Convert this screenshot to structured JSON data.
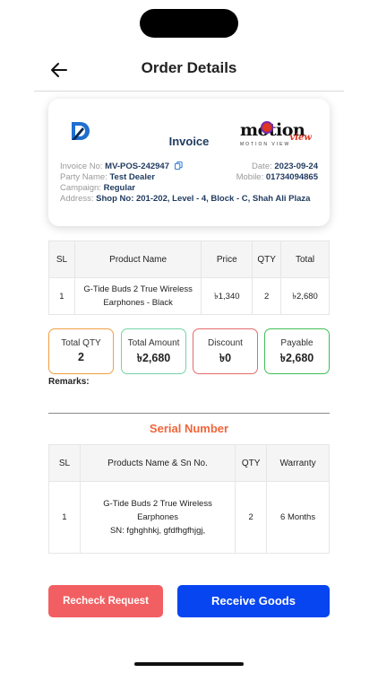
{
  "header": {
    "title": "Order Details",
    "back_icon": "arrow-left-icon"
  },
  "invoice": {
    "title": "Invoice",
    "brand": {
      "main": "motion",
      "accent": "view",
      "sub": "MOTION VIEW"
    },
    "invoice_no_label": "Invoice No:",
    "invoice_no": "MV-POS-242947",
    "date_label": "Date:",
    "date": "2023-09-24",
    "party_label": "Party Name:",
    "party": "Test Dealer",
    "mobile_label": "Mobile:",
    "mobile": "01734094865",
    "campaign_label": "Campaign:",
    "campaign": "Regular",
    "address_label": "Address:",
    "address": "Shop No: 201-202, Level - 4, Block - C, Shah Ali Plaza"
  },
  "products": {
    "headers": [
      "SL",
      "Product Name",
      "Price",
      "QTY",
      "Total"
    ],
    "rows": [
      {
        "sl": "1",
        "name": "G-Tide Buds 2 True Wireless Earphones - Black",
        "price": "৳1,340",
        "qty": "2",
        "total": "৳2,680"
      }
    ]
  },
  "summary": {
    "total_qty": {
      "label": "Total QTY",
      "value": "2"
    },
    "total_amount": {
      "label": "Total Amount",
      "value": "৳2,680"
    },
    "discount": {
      "label": "Discount",
      "value": "৳0"
    },
    "payable": {
      "label": "Payable",
      "value": "৳2,680"
    }
  },
  "remarks_label": "Remarks:",
  "serial": {
    "title": "Serial Number",
    "headers": [
      "SL",
      "Products Name & Sn No.",
      "QTY",
      "Warranty"
    ],
    "rows": [
      {
        "sl": "1",
        "name": "G-Tide Buds 2 True Wireless Earphones",
        "sn": "SN: fghghhkj, gfdfhgfhjgj,",
        "qty": "2",
        "warranty": "6 Months"
      }
    ]
  },
  "buttons": {
    "recheck": "Recheck Request",
    "receive": "Receive Goods"
  },
  "colors": {
    "accent_orange": "#f0653a",
    "primary_blue": "#0645f0",
    "danger_red": "#f25f62",
    "navy": "#1f3a5f"
  }
}
